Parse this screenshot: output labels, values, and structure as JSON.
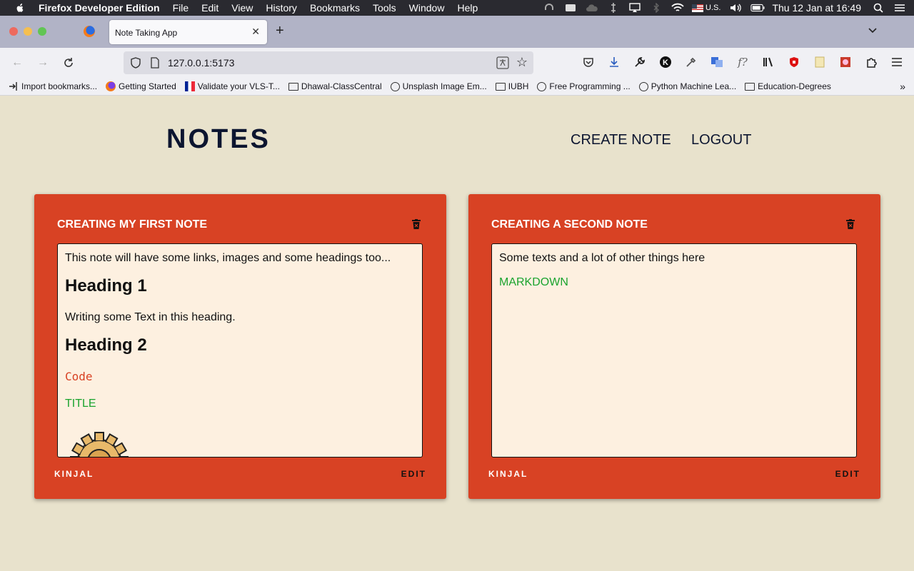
{
  "menubar": {
    "app_name": "Firefox Developer Edition",
    "items": [
      "File",
      "Edit",
      "View",
      "History",
      "Bookmarks",
      "Tools",
      "Window",
      "Help"
    ],
    "input_source": "U.S.",
    "clock": "Thu 12 Jan at  16:49"
  },
  "tabs": {
    "active_title": "Note Taking App"
  },
  "urlbar": {
    "url": "127.0.0.1:5173"
  },
  "bookmarks": [
    {
      "label": "Import bookmarks...",
      "icon": "import-icon"
    },
    {
      "label": "Getting Started",
      "icon": "firefox-icon"
    },
    {
      "label": "Validate your VLS-T...",
      "icon": "flag-icon"
    },
    {
      "label": "Dhawal-ClassCentral",
      "icon": "folder-icon"
    },
    {
      "label": "Unsplash Image Em...",
      "icon": "globe-icon"
    },
    {
      "label": "IUBH",
      "icon": "folder-icon"
    },
    {
      "label": "Free Programming ...",
      "icon": "globe-icon"
    },
    {
      "label": "Python Machine Lea...",
      "icon": "globe-icon"
    },
    {
      "label": "Education-Degrees",
      "icon": "folder-icon"
    }
  ],
  "app": {
    "brand": "NOTES",
    "nav_create": "CREATE NOTE",
    "nav_logout": "LOGOUT",
    "colors": {
      "background": "#e8e2cc",
      "card": "#d84224",
      "note_body": "#fdf0e0",
      "link_green": "#1aa32e",
      "brand": "#0c1530"
    }
  },
  "notes": [
    {
      "title": "CREATING MY FIRST NOTE",
      "intro": "This note will have some links, images and some headings too...",
      "heading1": "Heading 1",
      "heading1_text": "Writing some Text in this heading.",
      "heading2": "Heading 2",
      "code": "Code",
      "link": "TITLE",
      "image": "gear-image",
      "author": "KINJAL",
      "edit": "EDIT"
    },
    {
      "title": "CREATING A SECOND NOTE",
      "intro": "Some texts and a lot of other things here",
      "link": "MARKDOWN",
      "author": "KINJAL",
      "edit": "EDIT"
    }
  ]
}
